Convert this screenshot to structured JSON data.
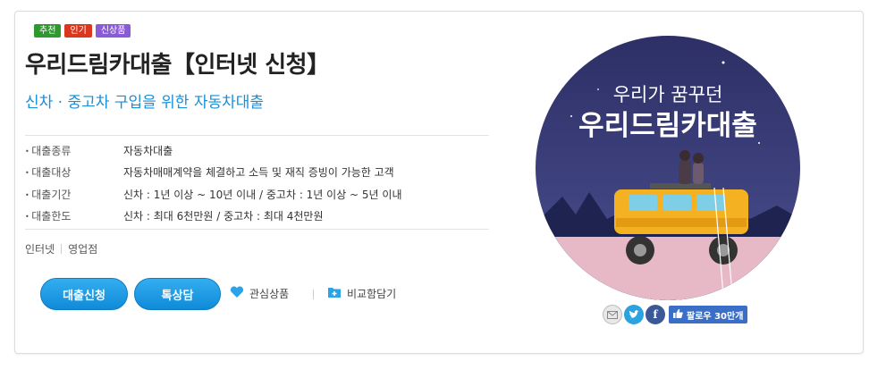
{
  "tags": [
    {
      "label": "추천",
      "color": "#2e9a2e"
    },
    {
      "label": "인기",
      "color": "#d9381e"
    },
    {
      "label": "신상품",
      "color": "#8a5bd6"
    }
  ],
  "product": {
    "title": "우리드림카대출【인터넷 신청】",
    "subtitle": "신차 · 중고차 구입을 위한 자동차대출"
  },
  "info": [
    {
      "key": "대출종류",
      "value": "자동차대출"
    },
    {
      "key": "대출대상",
      "value": "자동차매매계약을 체결하고 소득 및 재직 증빙이 가능한 고객"
    },
    {
      "key": "대출기간",
      "value": "신차 : 1년 이상 ~ 10년 이내 / 중고차 : 1년 이상 ~ 5년 이내"
    },
    {
      "key": "대출한도",
      "value": "신차 : 최대 6천만원 / 중고차 : 최대 4천만원"
    }
  ],
  "channels": [
    "인터넷",
    "영업점"
  ],
  "actions": {
    "apply": "대출신청",
    "consult": "톡상담",
    "wishlist": "관심상품",
    "compare": "비교함담기"
  },
  "image": {
    "line1": "우리가 꿈꾸던",
    "line2": "우리드림카대출"
  },
  "social": {
    "follow_label": "팔로우 30만개"
  },
  "colors": {
    "accent": "#1a8fd6",
    "button": "#1a96e0",
    "night_sky": "#3a3f7a",
    "car": "#f4b223"
  }
}
